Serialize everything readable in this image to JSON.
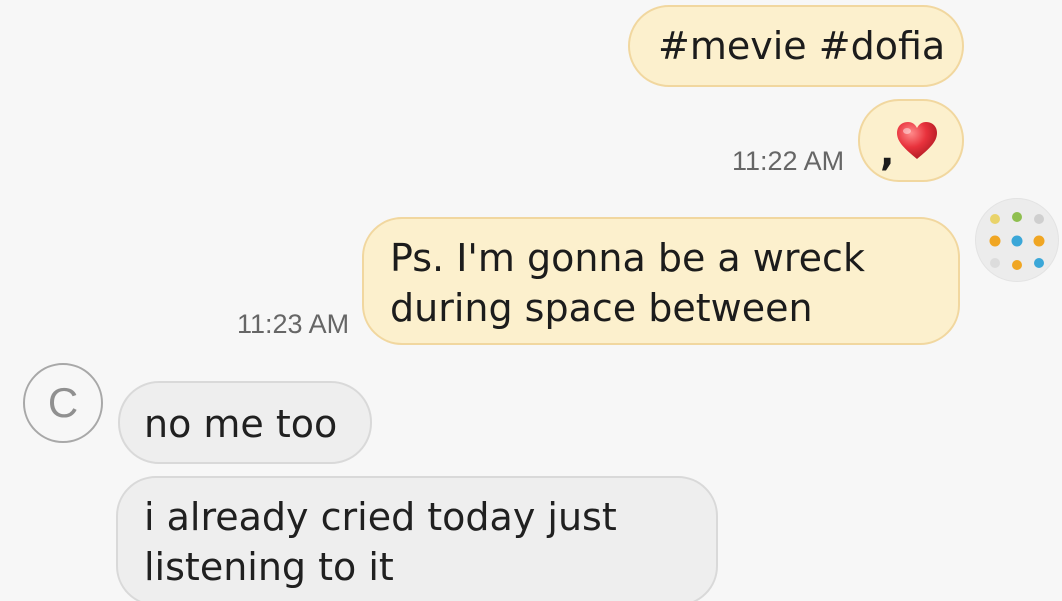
{
  "messages": {
    "sent": [
      {
        "text": "#mevie #dofia"
      },
      {
        "text": ",",
        "icon": "heart-emoji"
      },
      {
        "line1": "Ps. I'm gonna be a wreck",
        "line2": "during space between"
      }
    ],
    "received": [
      {
        "text": "no me too"
      },
      {
        "line1": "i already cried today just",
        "line2": "listening to it"
      }
    ]
  },
  "timestamps": {
    "first": "11:22 AM",
    "second": "11:23 AM"
  },
  "contact": {
    "initial": "C"
  },
  "colors": {
    "outgoing_bubble": "#fcf0cd",
    "outgoing_border": "#f1d79f",
    "incoming_bubble": "#eeeeee",
    "incoming_border": "#d9d9d9",
    "heart": "#e8323c",
    "background": "#f7f7f7"
  }
}
